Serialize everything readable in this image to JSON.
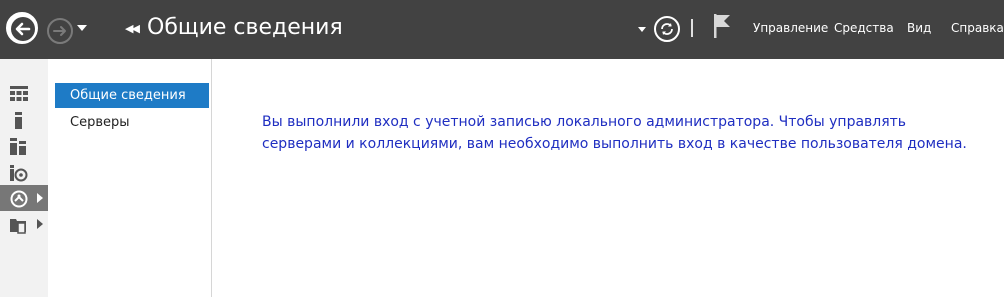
{
  "window": {
    "title": "Общие сведения"
  },
  "menu": {
    "items": [
      "Управление",
      "Средства",
      "Вид",
      "Справка"
    ]
  },
  "icons": {
    "back": "back-arrow-icon",
    "forward": "forward-arrow-icon",
    "refresh": "refresh-icon",
    "notifications": "flag-icon"
  },
  "sidebar": {
    "items": [
      {
        "icon": "dashboard-icon",
        "active": false,
        "expandable": false
      },
      {
        "icon": "local-server-icon",
        "active": false,
        "expandable": false
      },
      {
        "icon": "all-servers-icon",
        "active": false,
        "expandable": false
      },
      {
        "icon": "file-storage-icon",
        "active": false,
        "expandable": false
      },
      {
        "icon": "remote-desktop-services-icon",
        "active": true,
        "expandable": true
      },
      {
        "icon": "file-services-icon",
        "active": false,
        "expandable": true
      }
    ]
  },
  "panel": {
    "items": [
      "Общие сведения",
      "Серверы"
    ],
    "selected_index": 0
  },
  "main": {
    "message_line1": "Вы выполнили вход с учетной записью локального администратора. Чтобы управлять",
    "message_line2": "серверами и коллекциями, вам необходимо выполнить вход в качестве пользователя домена."
  },
  "colors": {
    "topbar": "#424242",
    "accent": "#1e7bc6",
    "message": "#1f2ec1"
  }
}
